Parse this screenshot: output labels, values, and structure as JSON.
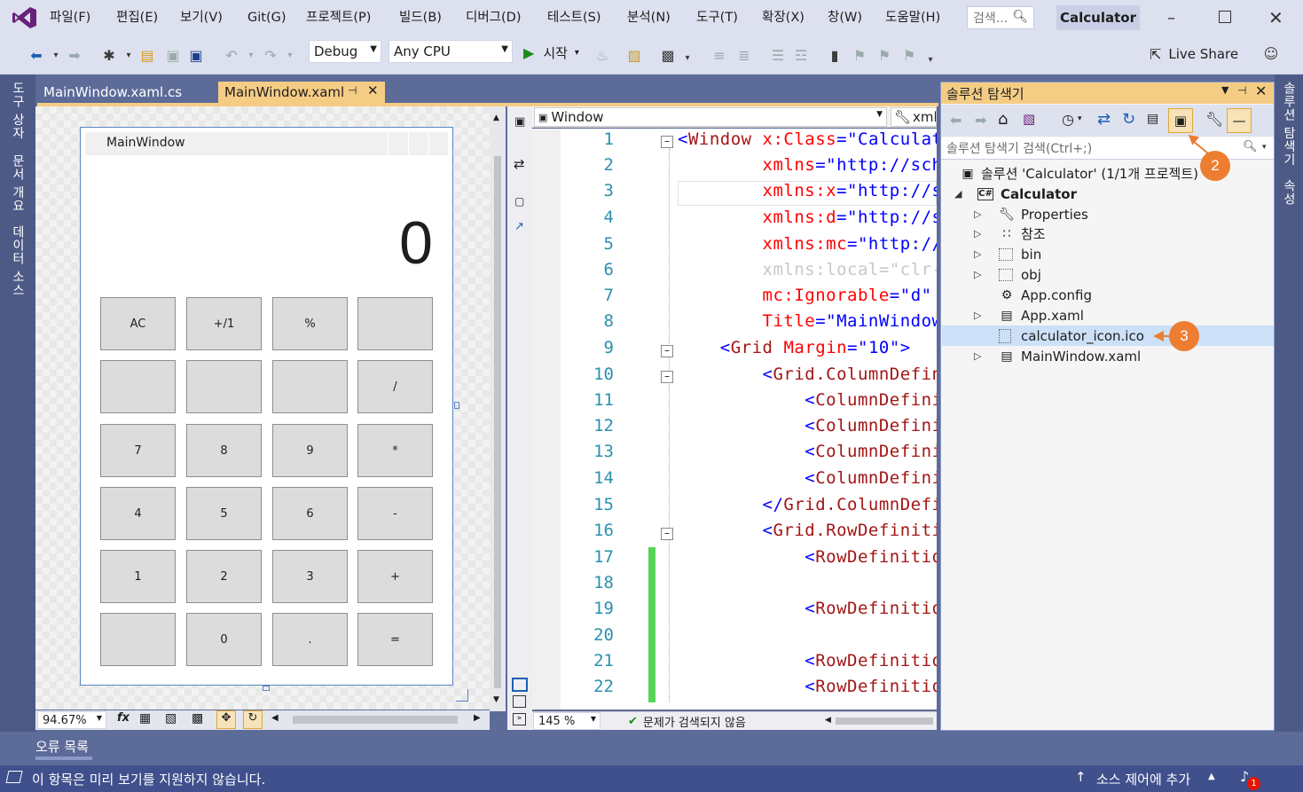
{
  "menu": {
    "items": [
      "파일(F)",
      "편집(E)",
      "보기(V)",
      "Git(G)",
      "프로젝트(P)",
      "빌드(B)",
      "디버그(D)",
      "테스트(S)",
      "분석(N)",
      "도구(T)",
      "확장(X)",
      "창(W)",
      "도움말(H)"
    ],
    "search_placeholder": "검색...",
    "app_title": "Calculator"
  },
  "toolbar": {
    "config": "Debug",
    "platform": "Any CPU",
    "start_label": "시작",
    "live_share": "Live Share"
  },
  "left_strip": {
    "tabs": [
      "도구 상자",
      "문서 개요",
      "데이터 소스"
    ]
  },
  "right_strip": {
    "tabs": [
      "솔루션 탐색기",
      "속성"
    ]
  },
  "tabs": {
    "inactive": "MainWindow.xaml.cs",
    "active": "MainWindow.xaml"
  },
  "designer": {
    "window_title": "MainWindow",
    "display": "0",
    "buttons": [
      [
        "AC",
        "+/1",
        "%",
        ""
      ],
      [
        "",
        "",
        "",
        "/"
      ],
      [
        "7",
        "8",
        "9",
        "*"
      ],
      [
        "4",
        "5",
        "6",
        "-"
      ],
      [
        "1",
        "2",
        "3",
        "+"
      ],
      [
        "",
        "0",
        ".",
        "="
      ]
    ],
    "zoom": "94.67%"
  },
  "editor": {
    "element_dropdown": "Window",
    "scope_dropdown": "xml",
    "zoom": "145 %",
    "status": "문제가 검색되지 않음",
    "line_numbers": [
      "1",
      "2",
      "3",
      "4",
      "5",
      "6",
      "7",
      "8",
      "9",
      "10",
      "11",
      "12",
      "13",
      "14",
      "15",
      "16",
      "17",
      "18",
      "19",
      "20",
      "21",
      "22"
    ]
  },
  "solution_explorer": {
    "title": "솔루션 탐색기",
    "search_placeholder": "솔루션 탐색기 검색(Ctrl+;)",
    "solution": "솔루션 'Calculator' (1/1개 프로젝트)",
    "project": "Calculator",
    "items": [
      "Properties",
      "참조",
      "bin",
      "obj",
      "App.config",
      "App.xaml",
      "calculator_icon.ico",
      "MainWindow.xaml"
    ],
    "callouts": [
      "2",
      "3"
    ]
  },
  "bottom": {
    "error_list_tab": "오류 목록",
    "status_message": "이 항목은 미리 보기를 지원하지 않습니다.",
    "source_control": "소스 제어에 추가",
    "notification_count": "1"
  },
  "colors": {
    "accent_orange": "#ed7d31",
    "vs_purple": "#68217a",
    "frame": "#5d6b99",
    "selection": "#cce0f7"
  }
}
